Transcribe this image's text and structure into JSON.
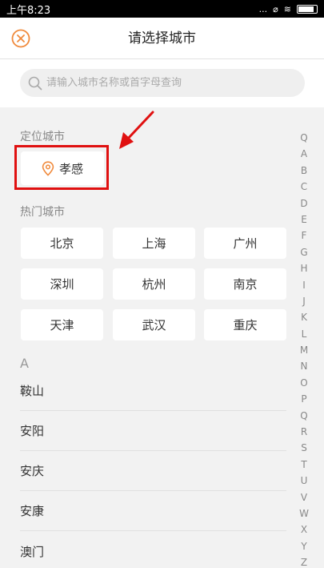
{
  "status_bar": {
    "time": "上午8:23",
    "signal": "...",
    "clock_icon_glyph": "⌀",
    "wifi_icon_glyph": "≋"
  },
  "header": {
    "title": "请选择城市"
  },
  "search": {
    "placeholder": "请输入城市名称或首字母查询"
  },
  "location": {
    "label": "定位城市",
    "city": "孝感"
  },
  "hot": {
    "label": "热门城市",
    "cities": [
      "北京",
      "上海",
      "广州",
      "深圳",
      "杭州",
      "南京",
      "天津",
      "武汉",
      "重庆"
    ]
  },
  "list": {
    "letter": "A",
    "cities": [
      "鞍山",
      "安阳",
      "安庆",
      "安康",
      "澳门"
    ]
  },
  "index_letters": [
    "Q",
    "A",
    "B",
    "C",
    "D",
    "E",
    "F",
    "G",
    "H",
    "I",
    "J",
    "K",
    "L",
    "M",
    "N",
    "O",
    "P",
    "Q",
    "R",
    "S",
    "T",
    "U",
    "V",
    "W",
    "X",
    "Y",
    "Z"
  ],
  "colors": {
    "accent": "#f08a3c",
    "highlight": "#e01010",
    "background": "#f2f2f2"
  }
}
